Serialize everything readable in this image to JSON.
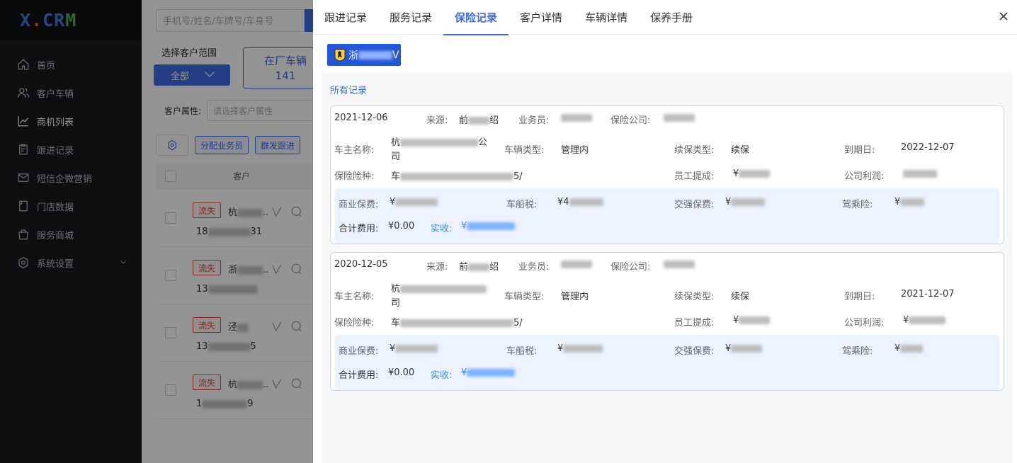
{
  "logo": {
    "prefix": "X",
    "dot": ".",
    "mid": "CR",
    "tail": "M"
  },
  "sidebar": {
    "items": [
      {
        "label": "首页",
        "icon": "home-icon"
      },
      {
        "label": "客户车辆",
        "icon": "users-icon"
      },
      {
        "label": "商机列表",
        "icon": "chart-line-icon",
        "active": true
      },
      {
        "label": "跟进记录",
        "icon": "clipboard-icon"
      },
      {
        "label": "短信企微营销",
        "icon": "mail-icon"
      },
      {
        "label": "门店数据",
        "icon": "document-icon"
      },
      {
        "label": "服务商城",
        "icon": "shopping-bag-icon"
      },
      {
        "label": "系统设置",
        "icon": "gear-icon"
      }
    ]
  },
  "main": {
    "search_placeholder": "手机号/姓名/车牌号/车身号",
    "range_label": "选择客户范围",
    "range_value": "全部",
    "stat_label": "在厂车辆",
    "stat_value": "141",
    "attr_label": "客户属性:",
    "attr_placeholder": "请选择客户属性",
    "btn_assign": "分配业务员",
    "btn_bulk_follow": "群发跟进",
    "col_customer": "客户",
    "rows": [
      {
        "tag": "流失",
        "name": "杭",
        "name_tail": "..",
        "phone_head": "18",
        "phone_tail": "31"
      },
      {
        "tag": "流失",
        "name": "浙",
        "name_tail": "..",
        "phone_head": "13",
        "phone_tail": ""
      },
      {
        "tag": "流失",
        "name": "泾",
        "name_tail": "",
        "phone_head": "13",
        "phone_tail": "5"
      },
      {
        "tag": "流失",
        "name": "杭",
        "name_tail": "..",
        "phone_head": "1",
        "phone_tail": "9"
      }
    ]
  },
  "drawer": {
    "tabs": [
      "跟进记录",
      "服务记录",
      "保险记录",
      "客户详情",
      "车辆详情",
      "保养手册"
    ],
    "active_tab": 2,
    "plate_prefix": "浙",
    "plate_suffix": "V",
    "all_records": "所有记录",
    "labels": {
      "source": "来源:",
      "salesman": "业务员:",
      "insurer": "保险公司:",
      "owner": "车主名称:",
      "vehicle_type": "车辆类型:",
      "renew_type": "续保类型:",
      "expiry": "到期日:",
      "coverage": "保险险种:",
      "commission": "员工提成:",
      "profit": "公司利润:",
      "commercial": "商业保费:",
      "vessel_tax": "车船税:",
      "compulsory": "交强保费:",
      "driver": "驾乘险:",
      "total": "合计费用:",
      "paid": "实收:"
    },
    "records": [
      {
        "date": "2021-12-06",
        "source_head": "前",
        "source_tail": "绍",
        "owner_head": "杭",
        "owner_tail": "公",
        "owner_line2": "司",
        "vehicle_type": "管理内",
        "renew_type": "续保",
        "expiry": "2022-12-07",
        "coverage_head": "车",
        "coverage_tail": "5/",
        "commission_head": "¥",
        "commercial_head": "¥",
        "vessel_head": "¥4",
        "compulsory_head": "¥",
        "driver_head": "¥",
        "total": "¥0.00",
        "paid_head": "¥"
      },
      {
        "date": "2020-12-05",
        "source_head": "前",
        "source_tail": "绍",
        "owner_head": "杭",
        "owner_tail": "",
        "owner_line2": "司",
        "vehicle_type": "管理内",
        "renew_type": "续保",
        "expiry": "2021-12-07",
        "coverage_head": "车",
        "coverage_tail": "5/",
        "commission_head": "¥",
        "profit_head": "¥",
        "commercial_head": "¥",
        "vessel_head": "¥",
        "compulsory_head": "¥",
        "driver_head": "¥",
        "total": "¥0.00",
        "paid_head": "¥"
      }
    ]
  }
}
